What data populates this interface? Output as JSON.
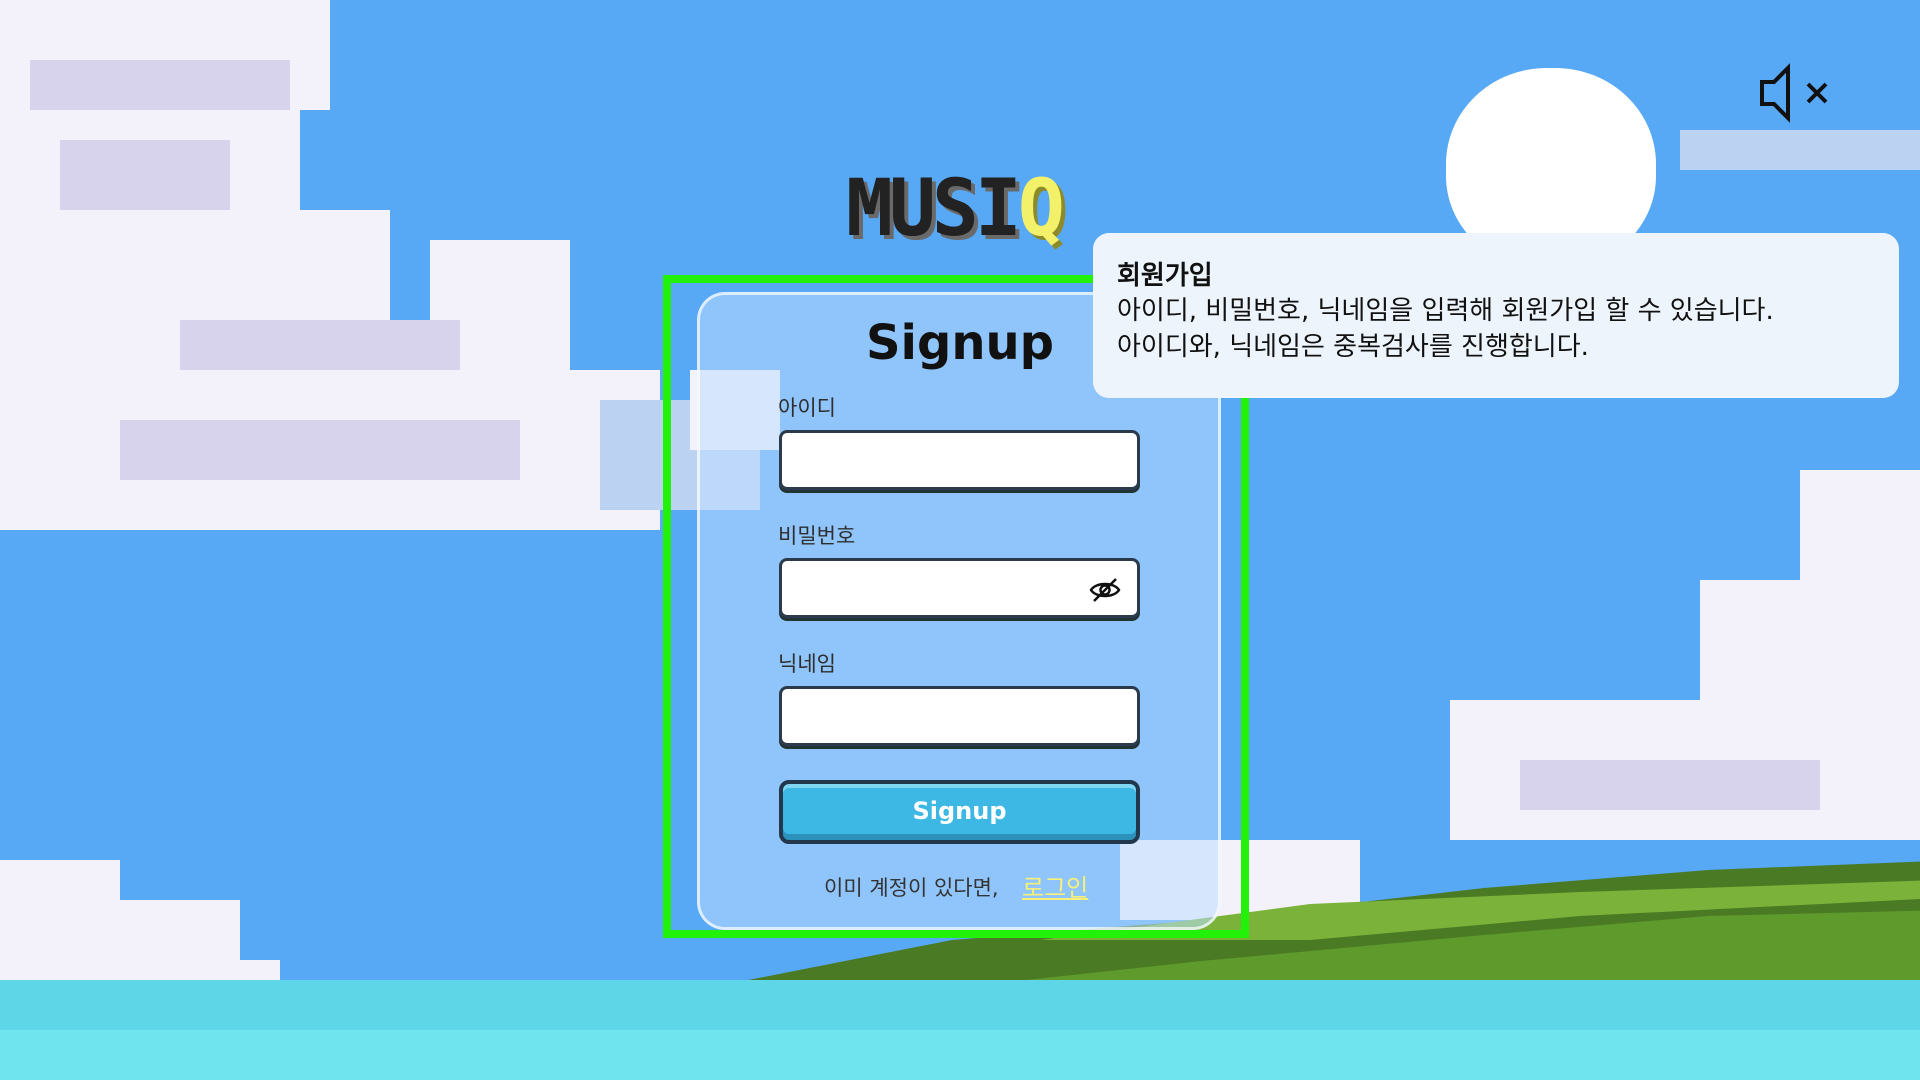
{
  "app": {
    "logo_main": "MUSI",
    "logo_accent": "Q"
  },
  "signup_form": {
    "title": "Signup",
    "id_label": "아이디",
    "id_value": "",
    "password_label": "비밀번호",
    "password_value": "",
    "nickname_label": "닉네임",
    "nickname_value": "",
    "submit_label": "Signup",
    "footer_text": "이미 계정이 있다면,",
    "login_link": "로그인"
  },
  "tooltip": {
    "title": "회원가입",
    "line1": "아이디, 비밀번호, 닉네임을 입력해 회원가입 할 수 있습니다.",
    "line2": "아이디와, 닉네임은 중복검사를 진행합니다."
  },
  "icons": {
    "sound": "mute-speaker-icon",
    "password_toggle": "eye-slash-icon"
  },
  "colors": {
    "sky": "#57a8f5",
    "highlight": "#22f20a",
    "button": "#3db8e4",
    "link": "#f6f07a",
    "logo_accent": "#f3f06a"
  }
}
